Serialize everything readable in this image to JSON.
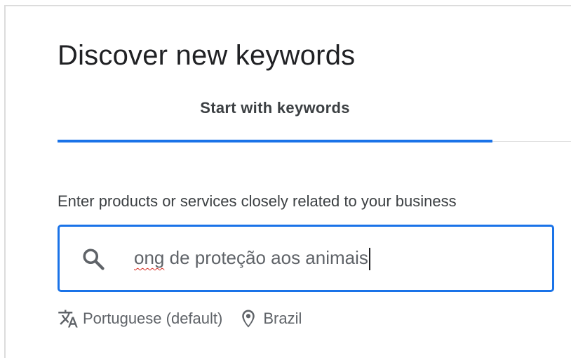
{
  "page": {
    "title": "Discover new keywords"
  },
  "tabs": [
    {
      "label": "Start with keywords",
      "active": true
    }
  ],
  "form": {
    "prompt": "Enter products or services closely related to your business",
    "search": {
      "value_misspelled_word": "ong",
      "value_rest": " de proteção aos animais",
      "icon": "search-icon"
    },
    "language": {
      "icon": "translate-icon",
      "label": "Portuguese (default)"
    },
    "location": {
      "icon": "location-pin-icon",
      "label": "Brazil"
    }
  },
  "colors": {
    "accent": "#1a73e8",
    "text_primary": "#202124",
    "text_secondary": "#5f6368",
    "spellcheck": "#d93025"
  }
}
